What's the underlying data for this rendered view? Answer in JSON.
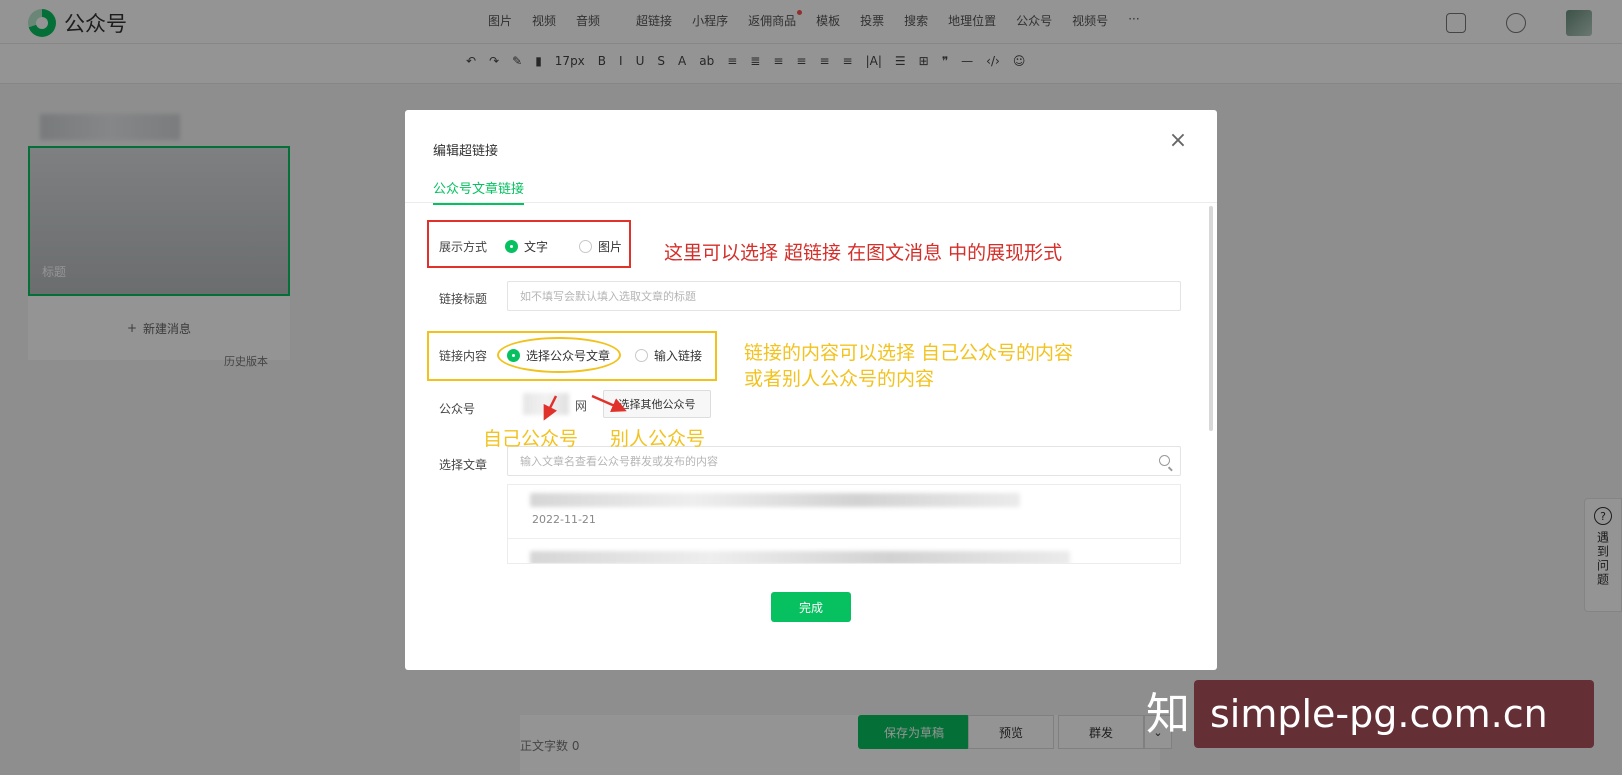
{
  "app": {
    "logo_text": "公众号",
    "nav": [
      "图片",
      "视频",
      "音频",
      "超链接",
      "小程序",
      "返佣商品",
      "模板",
      "投票",
      "搜索",
      "地理位置",
      "公众号",
      "视频号",
      "···"
    ],
    "toolbar": [
      "↶",
      "↷",
      "✎",
      "▮",
      "17px",
      "B",
      "I",
      "U",
      "S",
      "A",
      "ab",
      "≡",
      "≣",
      "≡",
      "≡",
      "≡",
      "≡",
      "|A|",
      "☰",
      "⊞",
      "❞",
      "—",
      "‹/›",
      "☺"
    ],
    "card_title": "标题",
    "new_message": "新建消息",
    "history": "历史版本",
    "word_count": "正文字数 0",
    "save_draft": "保存为草稿",
    "preview": "预览",
    "publish": "群发",
    "help_text": "遇到问题"
  },
  "dialog": {
    "title": "编辑超链接",
    "close": "×",
    "tab": "公众号文章链接",
    "display_label": "展示方式",
    "display_options": [
      "文字",
      "图片"
    ],
    "link_title_label": "链接标题",
    "link_title_placeholder": "如不填写会默认填入选取文章的标题",
    "link_content_label": "链接内容",
    "link_content_options": [
      "选择公众号文章",
      "输入链接"
    ],
    "account_label": "公众号",
    "account_suffix": "网",
    "other_account_button": "选择其他公众号",
    "select_article_label": "选择文章",
    "search_placeholder": "输入文章名查看公众号群发或发布的内容",
    "article_date": "2022-11-21",
    "done": "完成"
  },
  "annotations": {
    "red_note": "这里可以选择 超链接 在图文消息 中的展现形式",
    "yellow_note_1": "链接的内容可以选择  自己公众号的内容",
    "yellow_note_2": "或者别人公众号的内容",
    "own_account": "自己公众号",
    "other_account": "别人公众号"
  },
  "watermark": {
    "zhihu": "知",
    "text": "simple-pg.com.cn"
  },
  "colors": {
    "brand_green": "#07c160",
    "annotation_red": "#d4302b",
    "annotation_yellow": "#f2c320"
  }
}
